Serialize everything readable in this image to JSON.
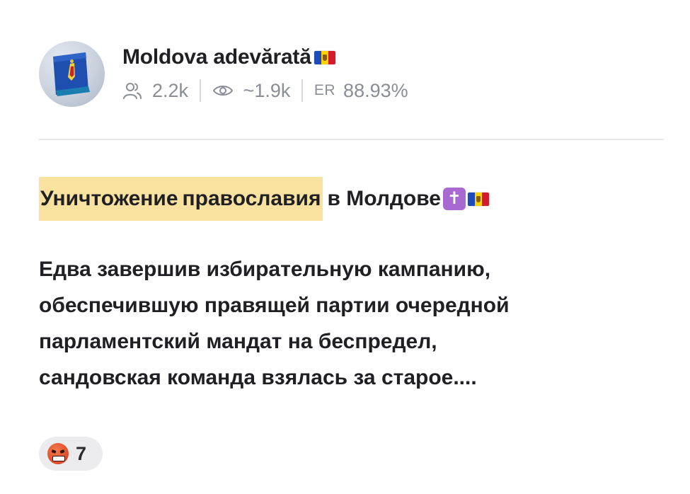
{
  "channel": {
    "name": "Moldova adevărată",
    "flag_icon": "moldova-flag-icon",
    "subscribers": "2.2k",
    "views": "~1.9k",
    "er_label": "ER",
    "er_value": "88.93%"
  },
  "post": {
    "title_highlight_1": "Уничтожение",
    "title_highlight_2": "православия",
    "title_rest": "в Молдове",
    "title_emojis": [
      "latin-cross-emoji",
      "moldova-flag-emoji"
    ],
    "body_lines": [
      "Едва завершив избирательную кампанию,",
      "обеспечившую правящей партии очередной",
      "парламентский мандат на беспредел,",
      "сандовская команда взялась за старое...."
    ]
  },
  "reactions": [
    {
      "emoji": "swearing-face-emoji",
      "count": "7"
    }
  ],
  "colors": {
    "highlight": "#f9e2a0",
    "muted_text": "#8a8d96",
    "divider": "#e8e9ec",
    "reaction_bg": "#ececee"
  }
}
